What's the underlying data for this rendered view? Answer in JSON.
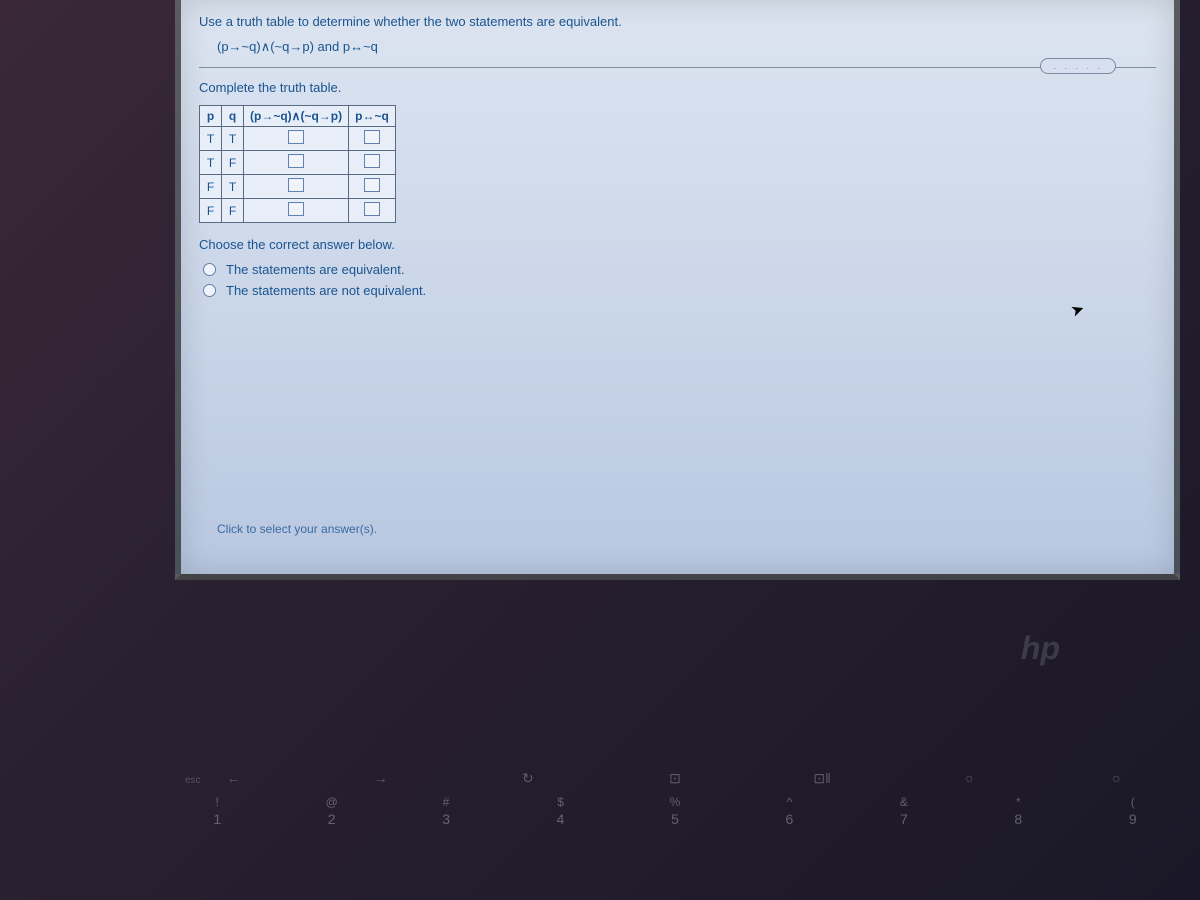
{
  "prompt": "Use a truth table to determine whether the two statements are equivalent.",
  "formula": "(p→~q)∧(~q→p) and p↔~q",
  "badge_dots": ". . . . .",
  "instruction": "Complete the truth table.",
  "table": {
    "headers": [
      "p",
      "q",
      "(p→~q)∧(~q→p)",
      "p↔~q"
    ],
    "rows": [
      {
        "p": "T",
        "q": "T"
      },
      {
        "p": "T",
        "q": "F"
      },
      {
        "p": "F",
        "q": "T"
      },
      {
        "p": "F",
        "q": "F"
      }
    ]
  },
  "choose_text": "Choose the correct answer below.",
  "options": [
    "The statements are equivalent.",
    "The statements are not equivalent."
  ],
  "footer_hint": "Click to select your answer(s).",
  "laptop_brand": "hp",
  "esc_key": "esc",
  "fn_keys": [
    "←",
    "→",
    "↻",
    "⊡",
    "⊡‖",
    "○",
    "○"
  ],
  "num_keys": [
    {
      "sym": "!",
      "num": "1"
    },
    {
      "sym": "@",
      "num": "2"
    },
    {
      "sym": "#",
      "num": "3"
    },
    {
      "sym": "$",
      "num": "4"
    },
    {
      "sym": "%",
      "num": "5"
    },
    {
      "sym": "^",
      "num": "6"
    },
    {
      "sym": "&",
      "num": "7"
    },
    {
      "sym": "*",
      "num": "8"
    },
    {
      "sym": "(",
      "num": "9"
    }
  ]
}
